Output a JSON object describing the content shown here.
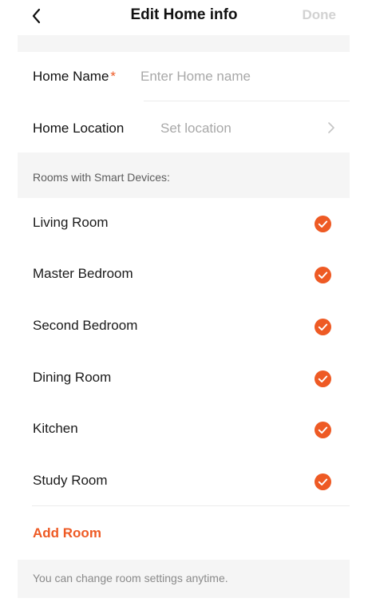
{
  "header": {
    "back_icon": "chevron-left-icon",
    "title": "Edit Home info",
    "done_label": "Done"
  },
  "form": {
    "home_name": {
      "label": "Home Name",
      "required_mark": "*",
      "value": "",
      "placeholder": "Enter Home name"
    },
    "home_location": {
      "label": "Home Location",
      "value": "Set location",
      "icon": "chevron-right-icon"
    }
  },
  "rooms": {
    "section_label": "Rooms with Smart Devices:",
    "items": [
      {
        "label": "Living Room",
        "checked": true
      },
      {
        "label": "Master Bedroom",
        "checked": true
      },
      {
        "label": "Second Bedroom",
        "checked": true
      },
      {
        "label": "Dining Room",
        "checked": true
      },
      {
        "label": "Kitchen",
        "checked": true
      },
      {
        "label": "Study Room",
        "checked": true
      }
    ],
    "add_label": "Add Room"
  },
  "footer": {
    "note": "You can change room settings anytime."
  },
  "colors": {
    "accent": "#ee5a24",
    "disabled": "#d2d2d2",
    "placeholder": "#a8a8a8",
    "band": "#f5f5f5"
  }
}
